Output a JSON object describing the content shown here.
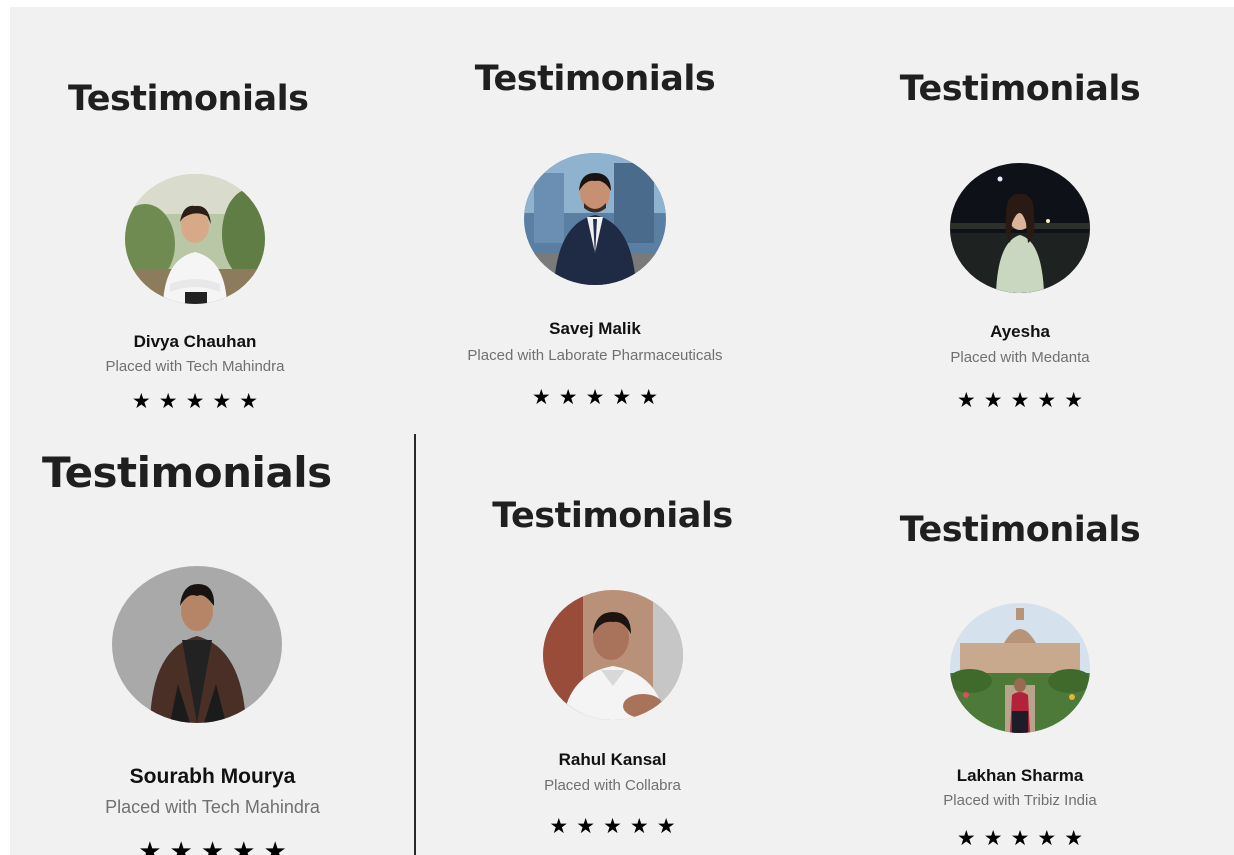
{
  "testimonials": [
    {
      "heading": "Testimonials",
      "name": "Divya Chauhan",
      "company": "Placed with Tech Mahindra",
      "rating": 5,
      "stars": "★★★★★"
    },
    {
      "heading": "Testimonials",
      "name": "Savej Malik",
      "company": "Placed with Laborate Pharmaceuticals",
      "rating": 5,
      "stars": "★★★★★"
    },
    {
      "heading": "Testimonials",
      "name": "Ayesha",
      "company": "Placed with Medanta",
      "rating": 5,
      "stars": "★★★★★"
    },
    {
      "heading": "Testimonials",
      "name": "Sourabh Mourya",
      "company": "Placed with Tech Mahindra",
      "rating": 5,
      "stars": "★★★★★"
    },
    {
      "heading": "Testimonials",
      "name": "Rahul Kansal",
      "company": "Placed with Collabra",
      "rating": 5,
      "stars": "★★★★★"
    },
    {
      "heading": "Testimonials",
      "name": "Lakhan Sharma",
      "company": "Placed with Tribiz India",
      "rating": 5,
      "stars": "★★★★★"
    }
  ],
  "colors": {
    "background": "#f1f1f1",
    "heading": "#1f1f1f",
    "name": "#111111",
    "company": "#707070",
    "star": "#000000"
  }
}
